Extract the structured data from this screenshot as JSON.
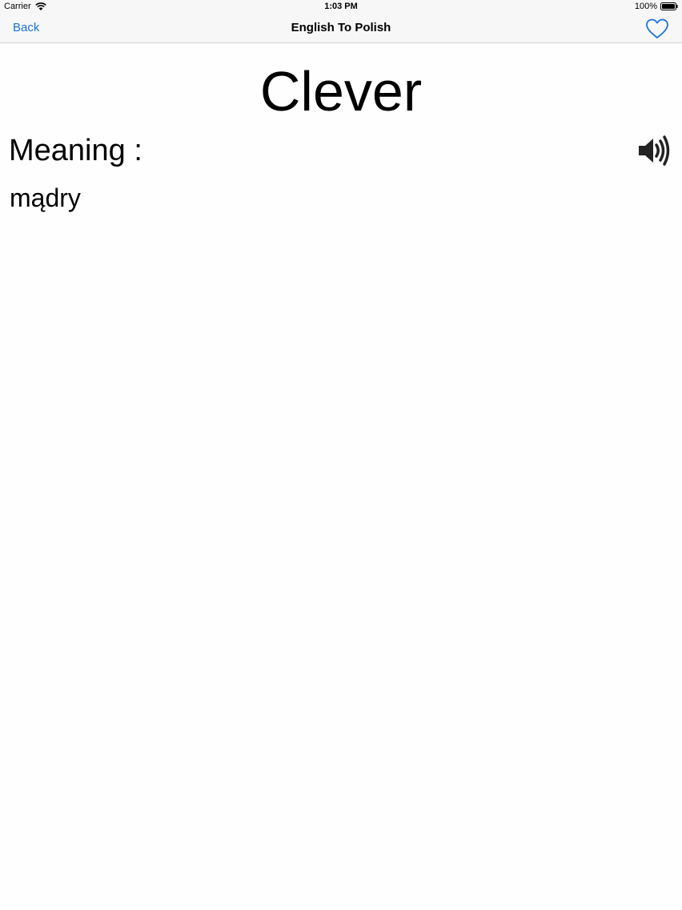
{
  "status_bar": {
    "carrier": "Carrier",
    "time": "1:03 PM",
    "battery": "100%"
  },
  "nav": {
    "back_label": "Back",
    "title": "English To Polish",
    "favorite_icon": "heart-icon"
  },
  "entry": {
    "word": "Clever",
    "meaning_label": "Meaning :",
    "meaning": "mądry",
    "speaker_icon": "speaker-icon"
  },
  "colors": {
    "accent": "#1a73d9",
    "bar_background": "#f7f7f7"
  }
}
